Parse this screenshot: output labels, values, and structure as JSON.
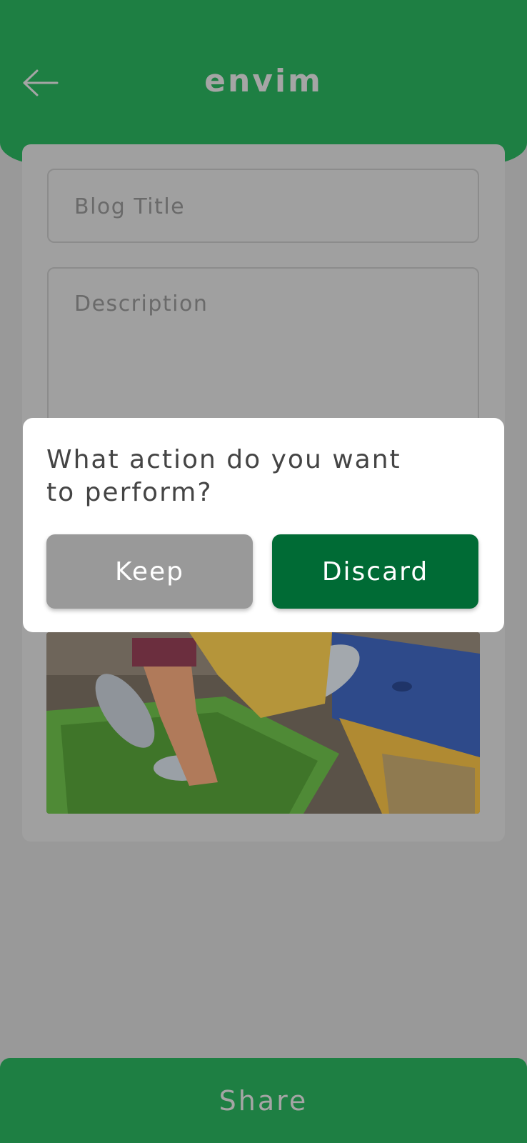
{
  "header": {
    "title": "envim",
    "back_icon": "arrow-left-icon"
  },
  "form": {
    "blog_title_placeholder": "Blog Title",
    "description_placeholder": "Description",
    "image_alt": "recycling-bottles-photo"
  },
  "dialog": {
    "question": "What action do you want to perform?",
    "keep_label": "Keep",
    "discard_label": "Discard"
  },
  "footer": {
    "share_label": "Share"
  },
  "colors": {
    "brand_green": "#1e7f43",
    "discard_green": "#006b35",
    "keep_gray": "#999999"
  }
}
